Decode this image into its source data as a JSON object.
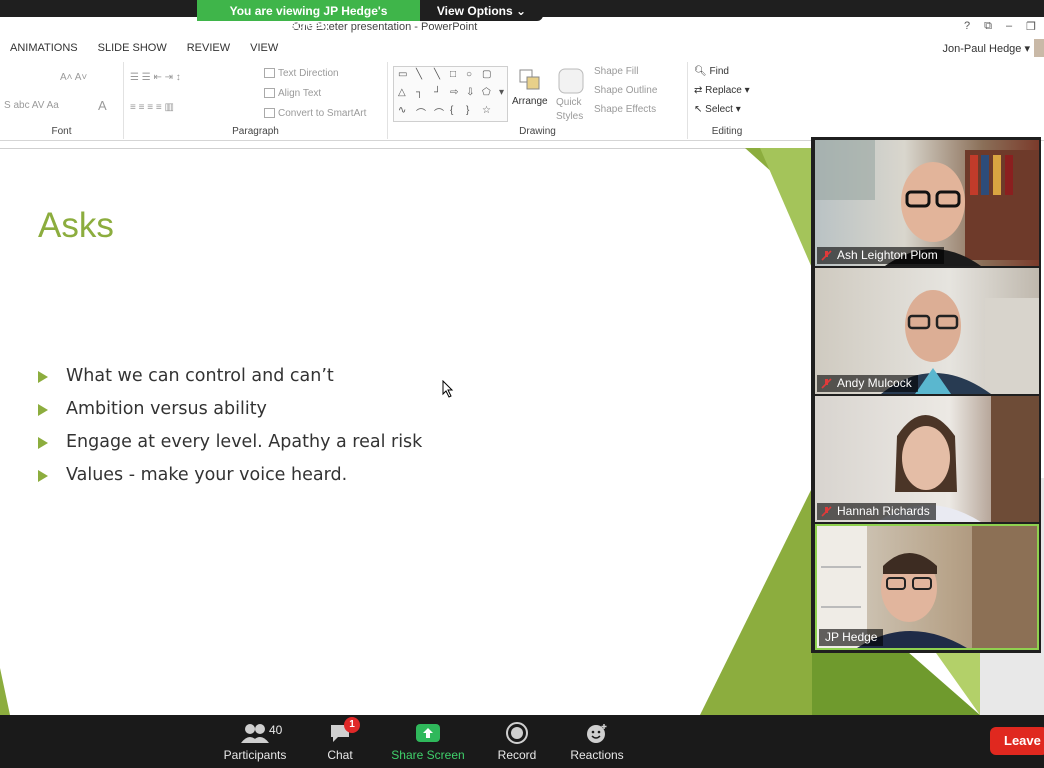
{
  "share_banner": {
    "viewing_text": "You are viewing JP Hedge's screen",
    "view_options_label": "View Options"
  },
  "powerpoint": {
    "window_title": "One Exeter presentation - PowerPoint",
    "window_controls": [
      "?",
      "⧉",
      "–",
      "❐"
    ],
    "user_name": "Jon-Paul Hedge",
    "tabs": [
      "ANIMATIONS",
      "SLIDE SHOW",
      "REVIEW",
      "VIEW"
    ],
    "ribbon": {
      "groups": {
        "font": "Font",
        "paragraph": "Paragraph",
        "drawing": "Drawing",
        "editing": "Editing"
      },
      "paragraph_items": [
        "Text Direction",
        "Align Text",
        "Convert to SmartArt"
      ],
      "drawing_items": {
        "arrange": "Arrange",
        "quick_styles": "Quick Styles",
        "shape_fill": "Shape Fill",
        "shape_outline": "Shape Outline",
        "shape_effects": "Shape Effects"
      },
      "editing_items": [
        "Find",
        "Replace",
        "Select"
      ]
    }
  },
  "slide": {
    "title": "Asks",
    "bullets": [
      "What we can control and can’t",
      "Ambition versus ability",
      "Engage at every level. Apathy a real risk",
      "Values - make your voice heard."
    ],
    "accent_color": "#8cad3e"
  },
  "participants_video": [
    {
      "name": "Ash Leighton Plom",
      "muted": true
    },
    {
      "name": "Andy Mulcock",
      "muted": true
    },
    {
      "name": "Hannah Richards",
      "muted": true
    },
    {
      "name": "JP Hedge",
      "muted": false
    }
  ],
  "toolbar": {
    "participants_label": "Participants",
    "participants_count": "40",
    "chat_label": "Chat",
    "chat_badge": "1",
    "share_label": "Share Screen",
    "record_label": "Record",
    "reactions_label": "Reactions",
    "leave_label": "Leave"
  }
}
